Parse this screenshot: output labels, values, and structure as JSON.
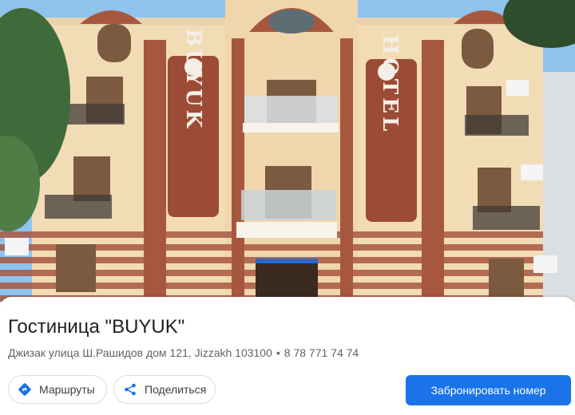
{
  "photo": {
    "sign_left": "BUYUK",
    "sign_right": "HOTEL",
    "sky_color": "#8fc3ee",
    "brick_color": "#a8573f",
    "facade_color": "#f1dcb6"
  },
  "place": {
    "title": "Гостиница \"BUYUK\"",
    "address": "Джизак улица Ш.Рашидов дом 121, Jizzakh 103100",
    "separator": "•",
    "phone": "8 78 771 74 74"
  },
  "actions": {
    "routes_label": "Маршруты",
    "share_label": "Поделиться",
    "book_label": "Забронировать номер"
  },
  "colors": {
    "primary": "#1a73e8",
    "text": "#202124",
    "secondary_text": "#5f6368"
  }
}
